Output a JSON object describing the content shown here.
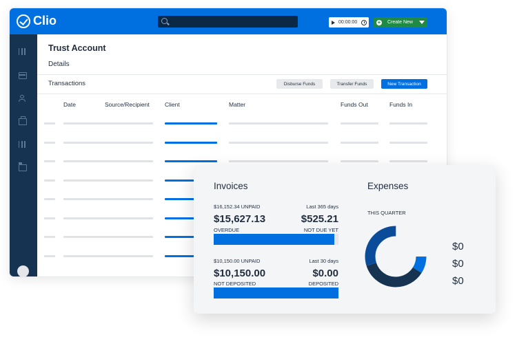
{
  "header": {
    "logo_text": "Clio",
    "timer": "00:00:00",
    "create_new_label": "Create New"
  },
  "page": {
    "title": "Trust Account",
    "details_label": "Details"
  },
  "transactions": {
    "section_label": "Transactions",
    "buttons": {
      "disburse": "Disburse Funds",
      "transfer": "Transfer Funds",
      "new": "New Transaction"
    },
    "columns": [
      "Date",
      "Source/Recipient",
      "Client",
      "Matter",
      "Funds Out",
      "Funds In"
    ]
  },
  "invoices": {
    "title": "Invoices",
    "last365": {
      "unpaid_label": "$16,152.34 UNPAID",
      "period_label": "Last 365 days",
      "overdue_amount": "$15,627.13",
      "overdue_label": "OVERDUE",
      "not_due_amount": "$525.21",
      "not_due_label": "NOT DUE YET",
      "overdue_fraction": 0.967
    },
    "last30": {
      "unpaid_label": "$10,150.00 UNPAID",
      "period_label": "Last 30 days",
      "not_deposited_amount": "$10,150.00",
      "not_deposited_label": "NOT DEPOSITED",
      "deposited_amount": "$0.00",
      "deposited_label": "DEPOSITED",
      "not_deposited_fraction": 1.0
    }
  },
  "expenses": {
    "title": "Expenses",
    "period_label": "THIS QUARTER",
    "values": [
      "$0",
      "$0",
      "$0"
    ],
    "donut_colors": [
      "#0070e0",
      "#163452",
      "#0a4c9a"
    ]
  }
}
